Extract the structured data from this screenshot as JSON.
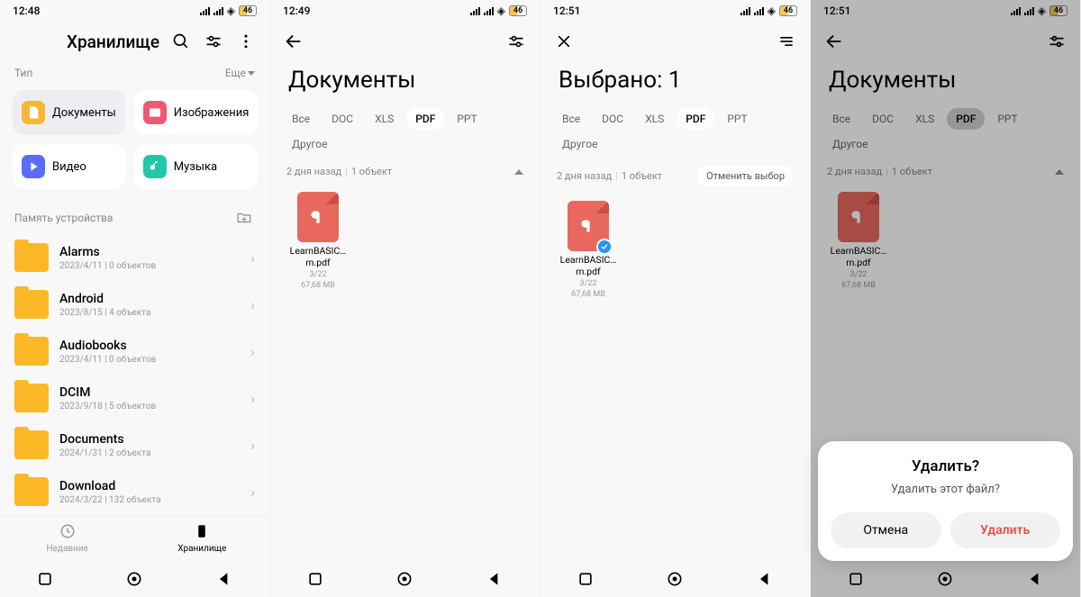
{
  "status": {
    "battery": "46"
  },
  "screens": [
    {
      "time": "12:48"
    },
    {
      "time": "12:49"
    },
    {
      "time": "12:51"
    },
    {
      "time": "12:51"
    }
  ],
  "s1": {
    "title": "Хранилище",
    "type_label": "Тип",
    "more_label": "Еще",
    "categories": [
      {
        "label": "Документы",
        "color": "#f7b733"
      },
      {
        "label": "Изображения",
        "color": "#ef5871"
      },
      {
        "label": "Видео",
        "color": "#5b6cf9"
      },
      {
        "label": "Музыка",
        "color": "#1fc8a8"
      }
    ],
    "storage_label": "Память устройства",
    "folders": [
      {
        "name": "Alarms",
        "meta": "2023/4/11  |  0 объектов"
      },
      {
        "name": "Android",
        "meta": "2023/8/15  |  4 объекта"
      },
      {
        "name": "Audiobooks",
        "meta": "2023/4/11  |  0 объектов"
      },
      {
        "name": "DCIM",
        "meta": "2023/9/18  |  5 объектов"
      },
      {
        "name": "Documents",
        "meta": "2024/1/31  |  2 объекта"
      },
      {
        "name": "Download",
        "meta": "2024/3/22  |  132 объекта"
      }
    ],
    "tabs": {
      "recent": "Недавние",
      "storage": "Хранилище"
    }
  },
  "filters": [
    "Все",
    "DOC",
    "XLS",
    "PDF",
    "PPT",
    "Другое"
  ],
  "docs_title": "Документы",
  "selected_title": "Выбрано: 1",
  "group": {
    "age": "2 дня назад",
    "count": "1 объект"
  },
  "deselect": "Отменить выбор",
  "file": {
    "name": "LearnBASIC…m.pdf",
    "date": "3/22",
    "size": "67,68 MB"
  },
  "dialog": {
    "title": "Удалить?",
    "message": "Удалить этот файл?",
    "cancel": "Отмена",
    "confirm": "Удалить"
  }
}
